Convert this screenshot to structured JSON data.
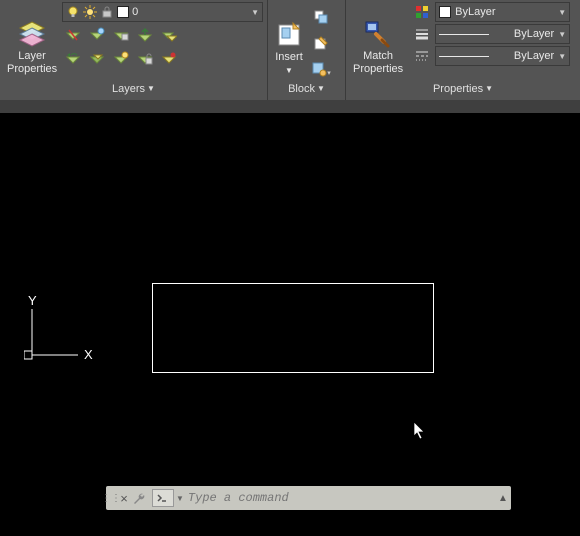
{
  "ribbon": {
    "layers": {
      "title": "Layers",
      "bigbtn_label_1": "Layer",
      "bigbtn_label_2": "Properties",
      "dropdown_value": "0"
    },
    "block": {
      "title": "Block",
      "insert_label": "Insert"
    },
    "properties": {
      "title": "Properties",
      "match_label_1": "Match",
      "match_label_2": "Properties",
      "color_value": "ByLayer",
      "lineweight_value": "ByLayer",
      "linetype_value": "ByLayer"
    }
  },
  "commandline": {
    "placeholder": "Type a command"
  }
}
